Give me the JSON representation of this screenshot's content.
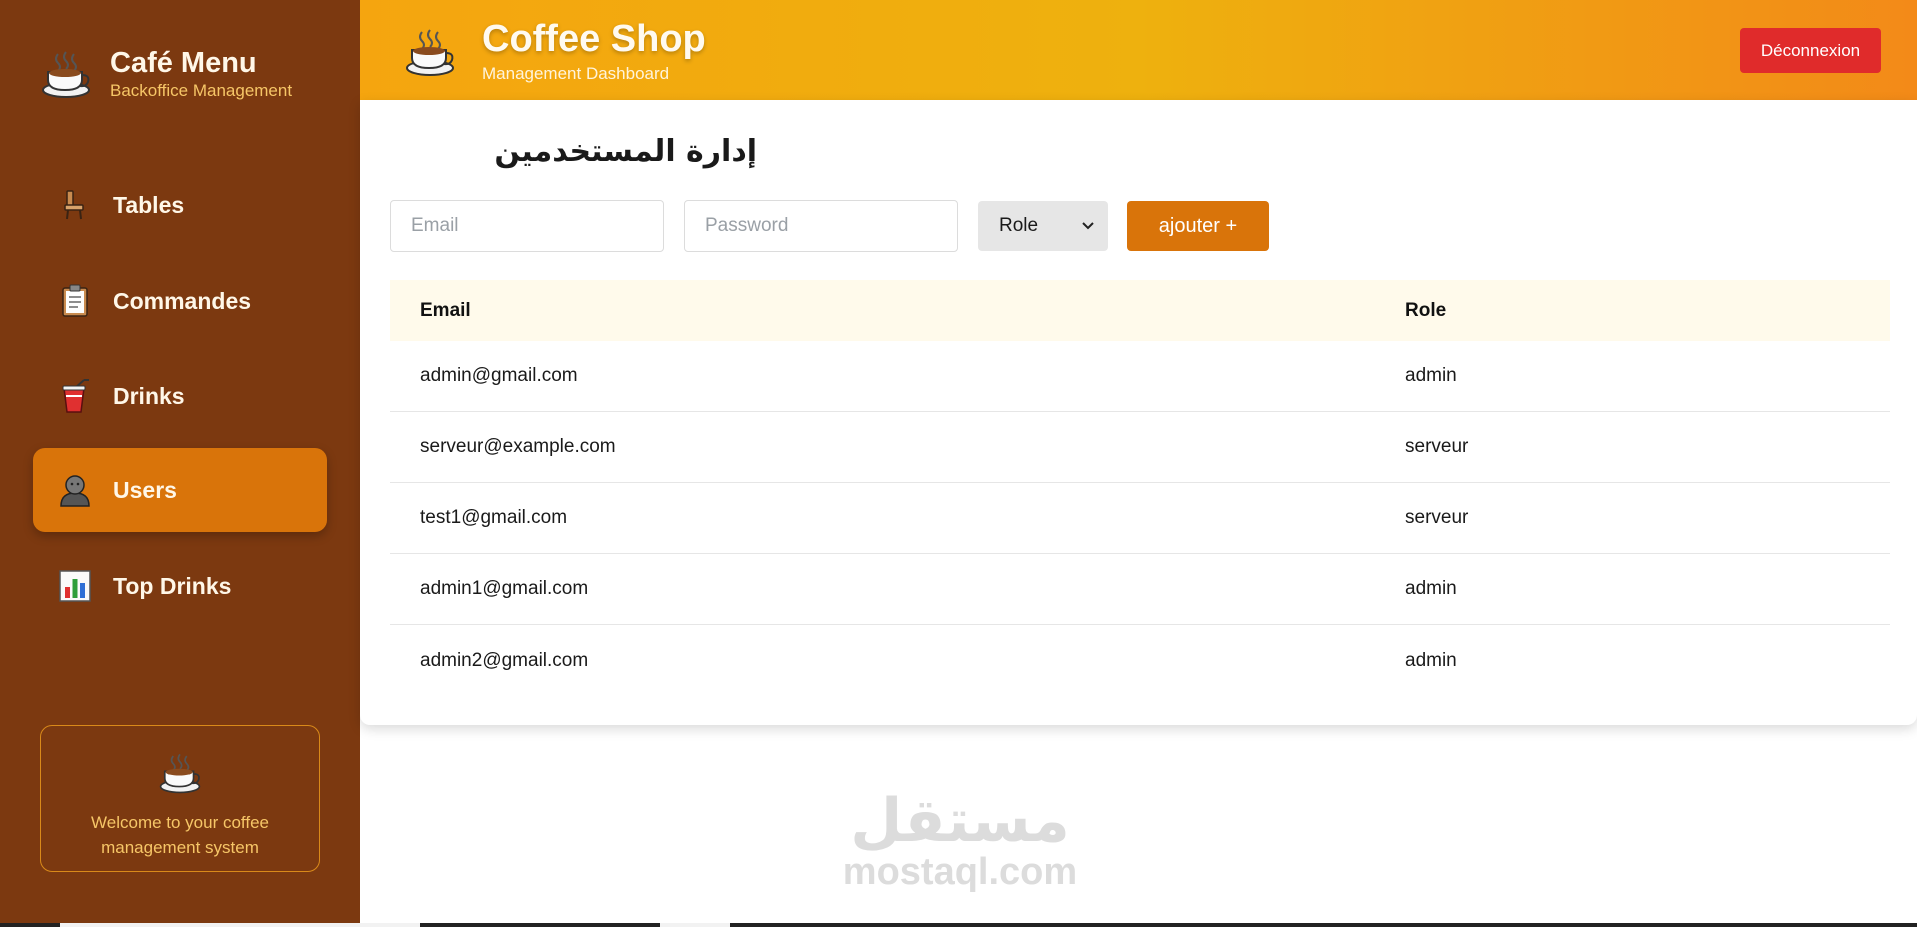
{
  "sidebar": {
    "brand_title": "Café Menu",
    "brand_subtitle": "Backoffice Management",
    "brand_icon": "coffee-cup-icon",
    "items": [
      {
        "label": "Tables",
        "icon": "chair-icon",
        "active": false
      },
      {
        "label": "Commandes",
        "icon": "clipboard-icon",
        "active": false
      },
      {
        "label": "Drinks",
        "icon": "cup-with-straw-icon",
        "active": false
      },
      {
        "label": "Users",
        "icon": "user-icon",
        "active": true
      },
      {
        "label": "Top Drinks",
        "icon": "bar-chart-icon",
        "active": false
      }
    ],
    "welcome_text": "Welcome to your coffee management system"
  },
  "header": {
    "title": "Coffee Shop",
    "subtitle": "Management Dashboard",
    "logout_label": "Déconnexion"
  },
  "main": {
    "page_title": "إدارة المستخدمين",
    "form": {
      "email_placeholder": "Email",
      "email_value": "",
      "password_placeholder": "Password",
      "password_value": "",
      "role_selected": "Role",
      "add_label": "ajouter +"
    },
    "table": {
      "columns": [
        "Email",
        "Role"
      ],
      "rows": [
        {
          "email": "admin@gmail.com",
          "role": "admin"
        },
        {
          "email": "serveur@example.com",
          "role": "serveur"
        },
        {
          "email": "test1@gmail.com",
          "role": "serveur"
        },
        {
          "email": "admin1@gmail.com",
          "role": "admin"
        },
        {
          "email": "admin2@gmail.com",
          "role": "admin"
        }
      ]
    }
  },
  "watermark": {
    "arabic": "مستقل",
    "latin": "mostaql.com"
  },
  "colors": {
    "sidebar_bg": "#7c3910",
    "active_item": "#d9740a",
    "header_gradient_start": "#f5a50f",
    "header_gradient_end": "#f38a18",
    "logout_bg": "#e02b2b",
    "add_button_bg": "#d9740a",
    "table_header_bg": "#fffaeb"
  }
}
